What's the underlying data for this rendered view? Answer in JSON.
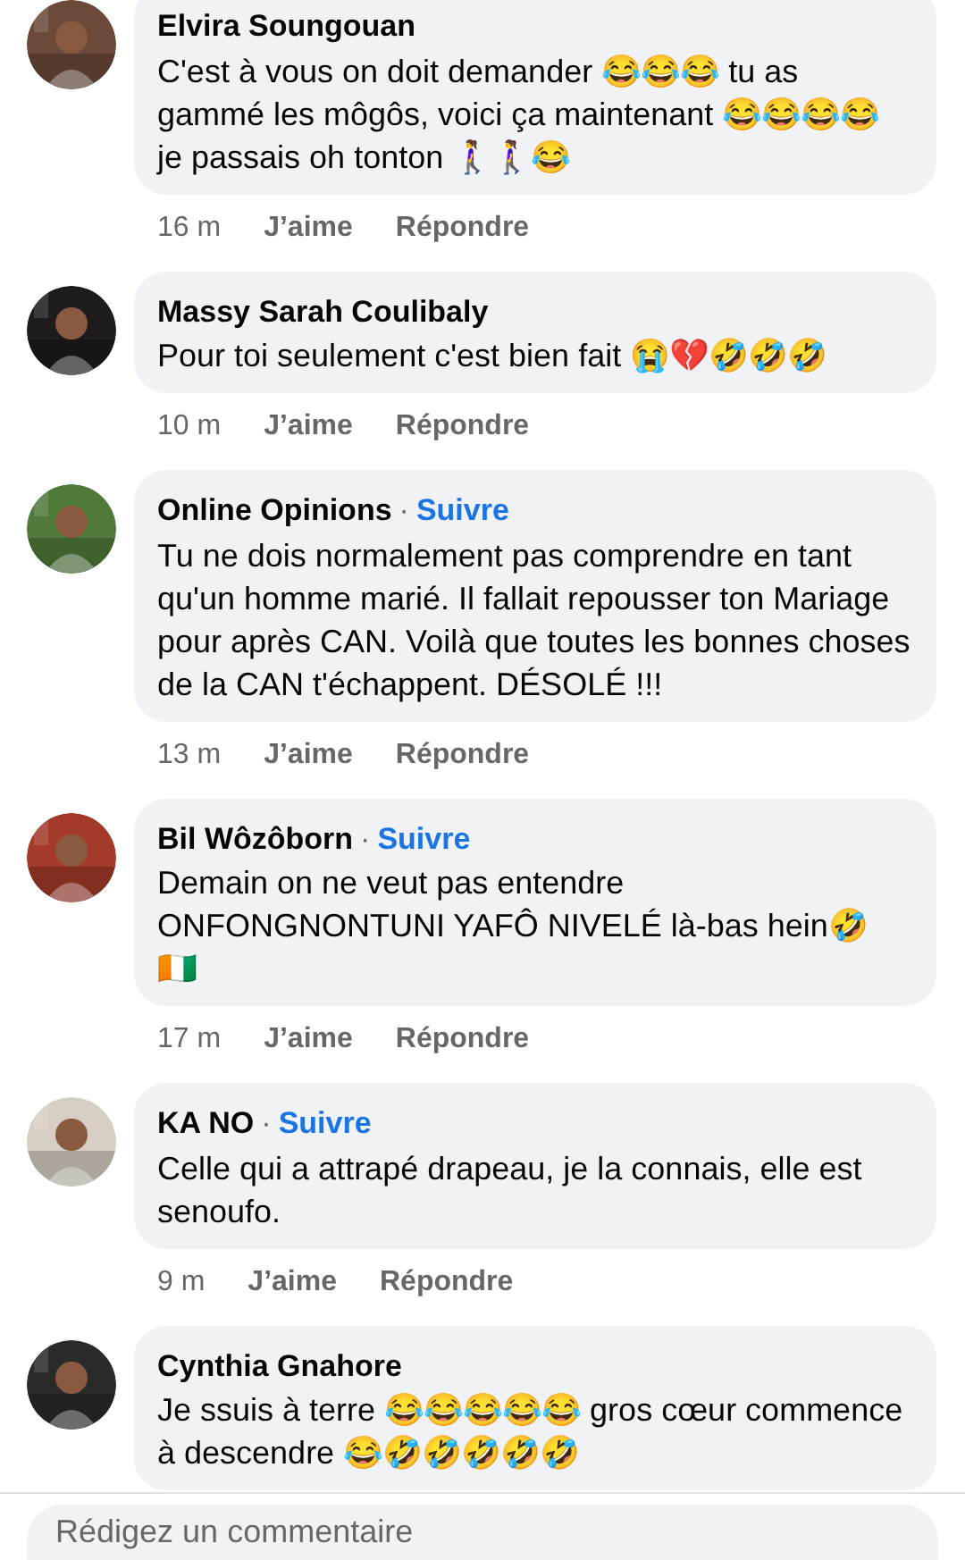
{
  "comments": [
    {
      "author": "Elvira Soungouan",
      "text": "C'est à vous on doit demander 😂😂😂 tu as gammé les môgôs, voici ça maintenant 😂😂😂😂 je passais oh tonton 🚶‍♀️🚶‍♀️😂",
      "time": "16 m",
      "like": "J’aime",
      "reply": "Répondre"
    },
    {
      "author": "Massy Sarah Coulibaly",
      "text": "Pour toi seulement c'est bien fait 😭💔🤣🤣🤣",
      "time": "10 m",
      "like": "J’aime",
      "reply": "Répondre"
    },
    {
      "author": "Online Opinions",
      "separator": "·",
      "follow": "Suivre",
      "text": "Tu ne dois normalement pas comprendre en tant qu'un homme marié. Il fallait repousser ton Mariage pour après CAN. Voilà que toutes les bonnes choses de la CAN t'échappent. DÉSOLÉ !!!",
      "time": "13 m",
      "like": "J’aime",
      "reply": "Répondre"
    },
    {
      "author": "Bil Wôzôborn",
      "separator": "·",
      "follow": "Suivre",
      "text": "Demain on ne veut pas entendre ONFONGNONTUNI YAFÔ NIVELÉ là-bas hein🤣 🇨🇮",
      "time": "17 m",
      "like": "J’aime",
      "reply": "Répondre"
    },
    {
      "author": "KA NO",
      "separator": "·",
      "follow": "Suivre",
      "text": "Celle qui a attrapé drapeau, je la connais, elle est senoufo.",
      "time": "9 m",
      "like": "J’aime",
      "reply": "Répondre"
    },
    {
      "author": "Cynthia Gnahore",
      "text": "Je ssuis à terre 😂😂😂😂😂 gros cœur commence à descendre 😂🤣🤣🤣🤣🤣"
    }
  ],
  "composer": {
    "placeholder": "Rédigez un commentaire"
  }
}
